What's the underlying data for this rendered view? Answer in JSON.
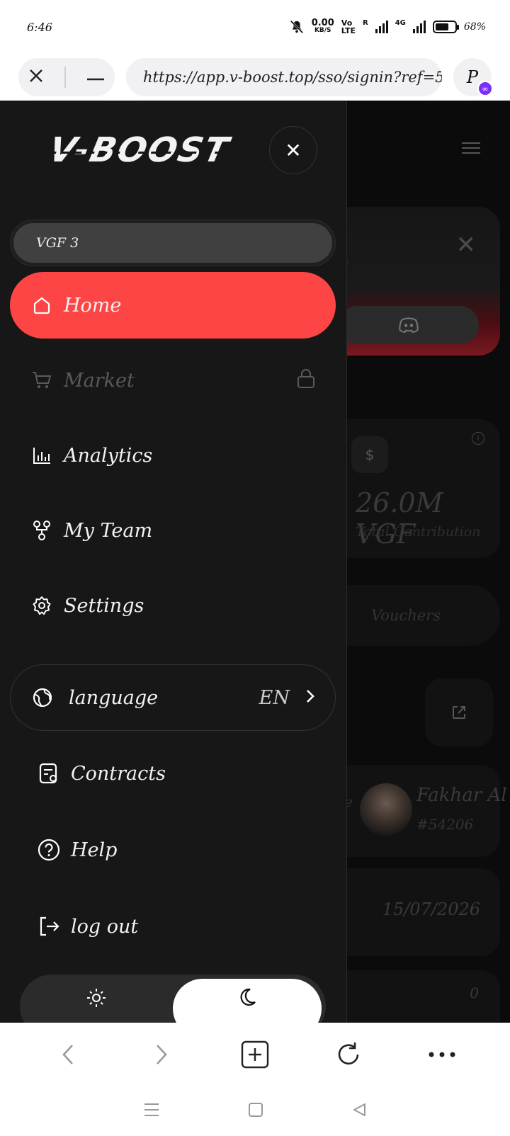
{
  "status_bar": {
    "time": "6:46",
    "net_speed_value": "0.00",
    "net_speed_unit": "KB/S",
    "volte_top": "Vo",
    "volte_bottom": "LTE",
    "roaming": "R",
    "network": "4G",
    "battery_percent": "68%",
    "battery_level": 0.68
  },
  "browser": {
    "url": "https://app.v-boost.top/sso/signin?ref=5...",
    "profile_letter": "P"
  },
  "drawer": {
    "logo": "V-BOOST",
    "wallet_label": "VGF 3",
    "nav": [
      {
        "label": "Home",
        "icon": "home-icon",
        "state": "active"
      },
      {
        "label": "Market",
        "icon": "cart-icon",
        "state": "locked"
      },
      {
        "label": "Analytics",
        "icon": "bar-chart-icon",
        "state": "normal"
      },
      {
        "label": "My Team",
        "icon": "team-tree-icon",
        "state": "normal"
      },
      {
        "label": "Settings",
        "icon": "gear-icon",
        "state": "normal"
      }
    ],
    "language": {
      "label": "language",
      "code": "EN"
    },
    "secondary": [
      {
        "label": "Contracts",
        "icon": "contract-icon"
      },
      {
        "label": "Help",
        "icon": "help-icon"
      },
      {
        "label": "log out",
        "icon": "logout-icon"
      }
    ],
    "theme": {
      "selected": "dark"
    }
  },
  "background_page": {
    "total_contribution_value": "26.0M VGF",
    "total_contribution_label": "Total Contribution",
    "vouchers_label": "Vouchers",
    "user_name": "Fakhar Al",
    "user_id": "#54206",
    "user_prefix": "e",
    "date": "15/07/2026",
    "zero_value": "0",
    "faint_text": "s"
  },
  "colors": {
    "accent": "#fd4545",
    "drawer_bg": "#171717",
    "page_bg": "#0b0b0b"
  }
}
